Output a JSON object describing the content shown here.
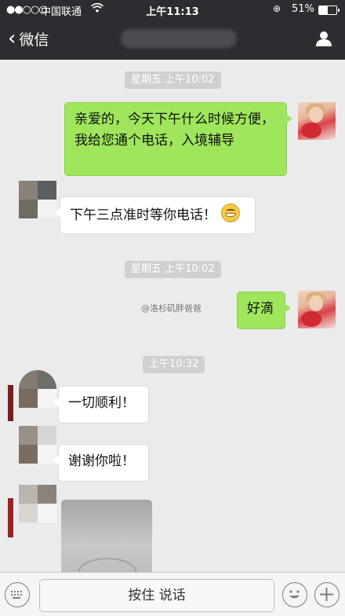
{
  "status_bar": {
    "signal": "●●○○○",
    "carrier": "中国联通",
    "time": "上午11:13",
    "battery": "51%",
    "battery_level": 0.51
  },
  "nav": {
    "back_label": "微信"
  },
  "messages": [
    {
      "type": "time",
      "text": "星期五 上午10:02"
    },
    {
      "type": "text",
      "from": "me",
      "text": "亲爱的，今天下午什么时候方便，我给您通个电话，入境辅导"
    },
    {
      "type": "text",
      "from": "other",
      "text": "下午三点准时等你电话！"
    },
    {
      "type": "time",
      "text": "星期五 上午10:02"
    },
    {
      "type": "text",
      "from": "me",
      "text": "好滴"
    },
    {
      "type": "time",
      "text": "上午10:32"
    },
    {
      "type": "text",
      "from": "other",
      "text": "一切顺利！"
    },
    {
      "type": "text",
      "from": "other",
      "text": "谢谢你啦！"
    },
    {
      "type": "image",
      "from": "other"
    }
  ],
  "watermark": "@洛杉矶胖爸爸",
  "input_bar": {
    "hold_to_talk": "按住 说话"
  },
  "colors": {
    "nav_bg": "#2d2d31",
    "chat_bg": "#ebebeb",
    "my_bubble": "#9fe65c",
    "their_bubble": "#ffffff"
  }
}
